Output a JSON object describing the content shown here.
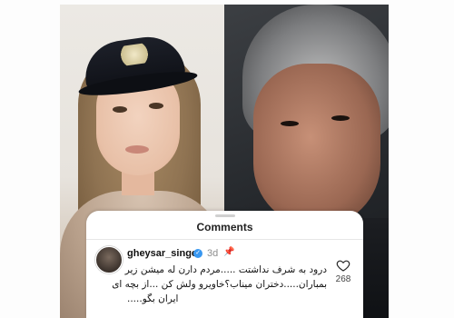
{
  "comments_panel": {
    "title": "Comments",
    "comment": {
      "username": "gheysar_singer",
      "verified": true,
      "time": "3d",
      "pinned": true,
      "lines": [
        "درود به شرف نداشتت .....مردم دارن له میشن زیر",
        "بمباران.....دختران میناب؟خاویرو ولش کن ...از بچه ای",
        "ایران بگو....."
      ],
      "like_count": "268"
    }
  },
  "icons": {
    "verified": "verified-badge-icon",
    "pin": "pin-icon",
    "like": "heart-icon"
  },
  "colors": {
    "verified_blue": "#3897f0",
    "card_bg": "#ffffff",
    "secondary_text": "#8e8e8e"
  }
}
